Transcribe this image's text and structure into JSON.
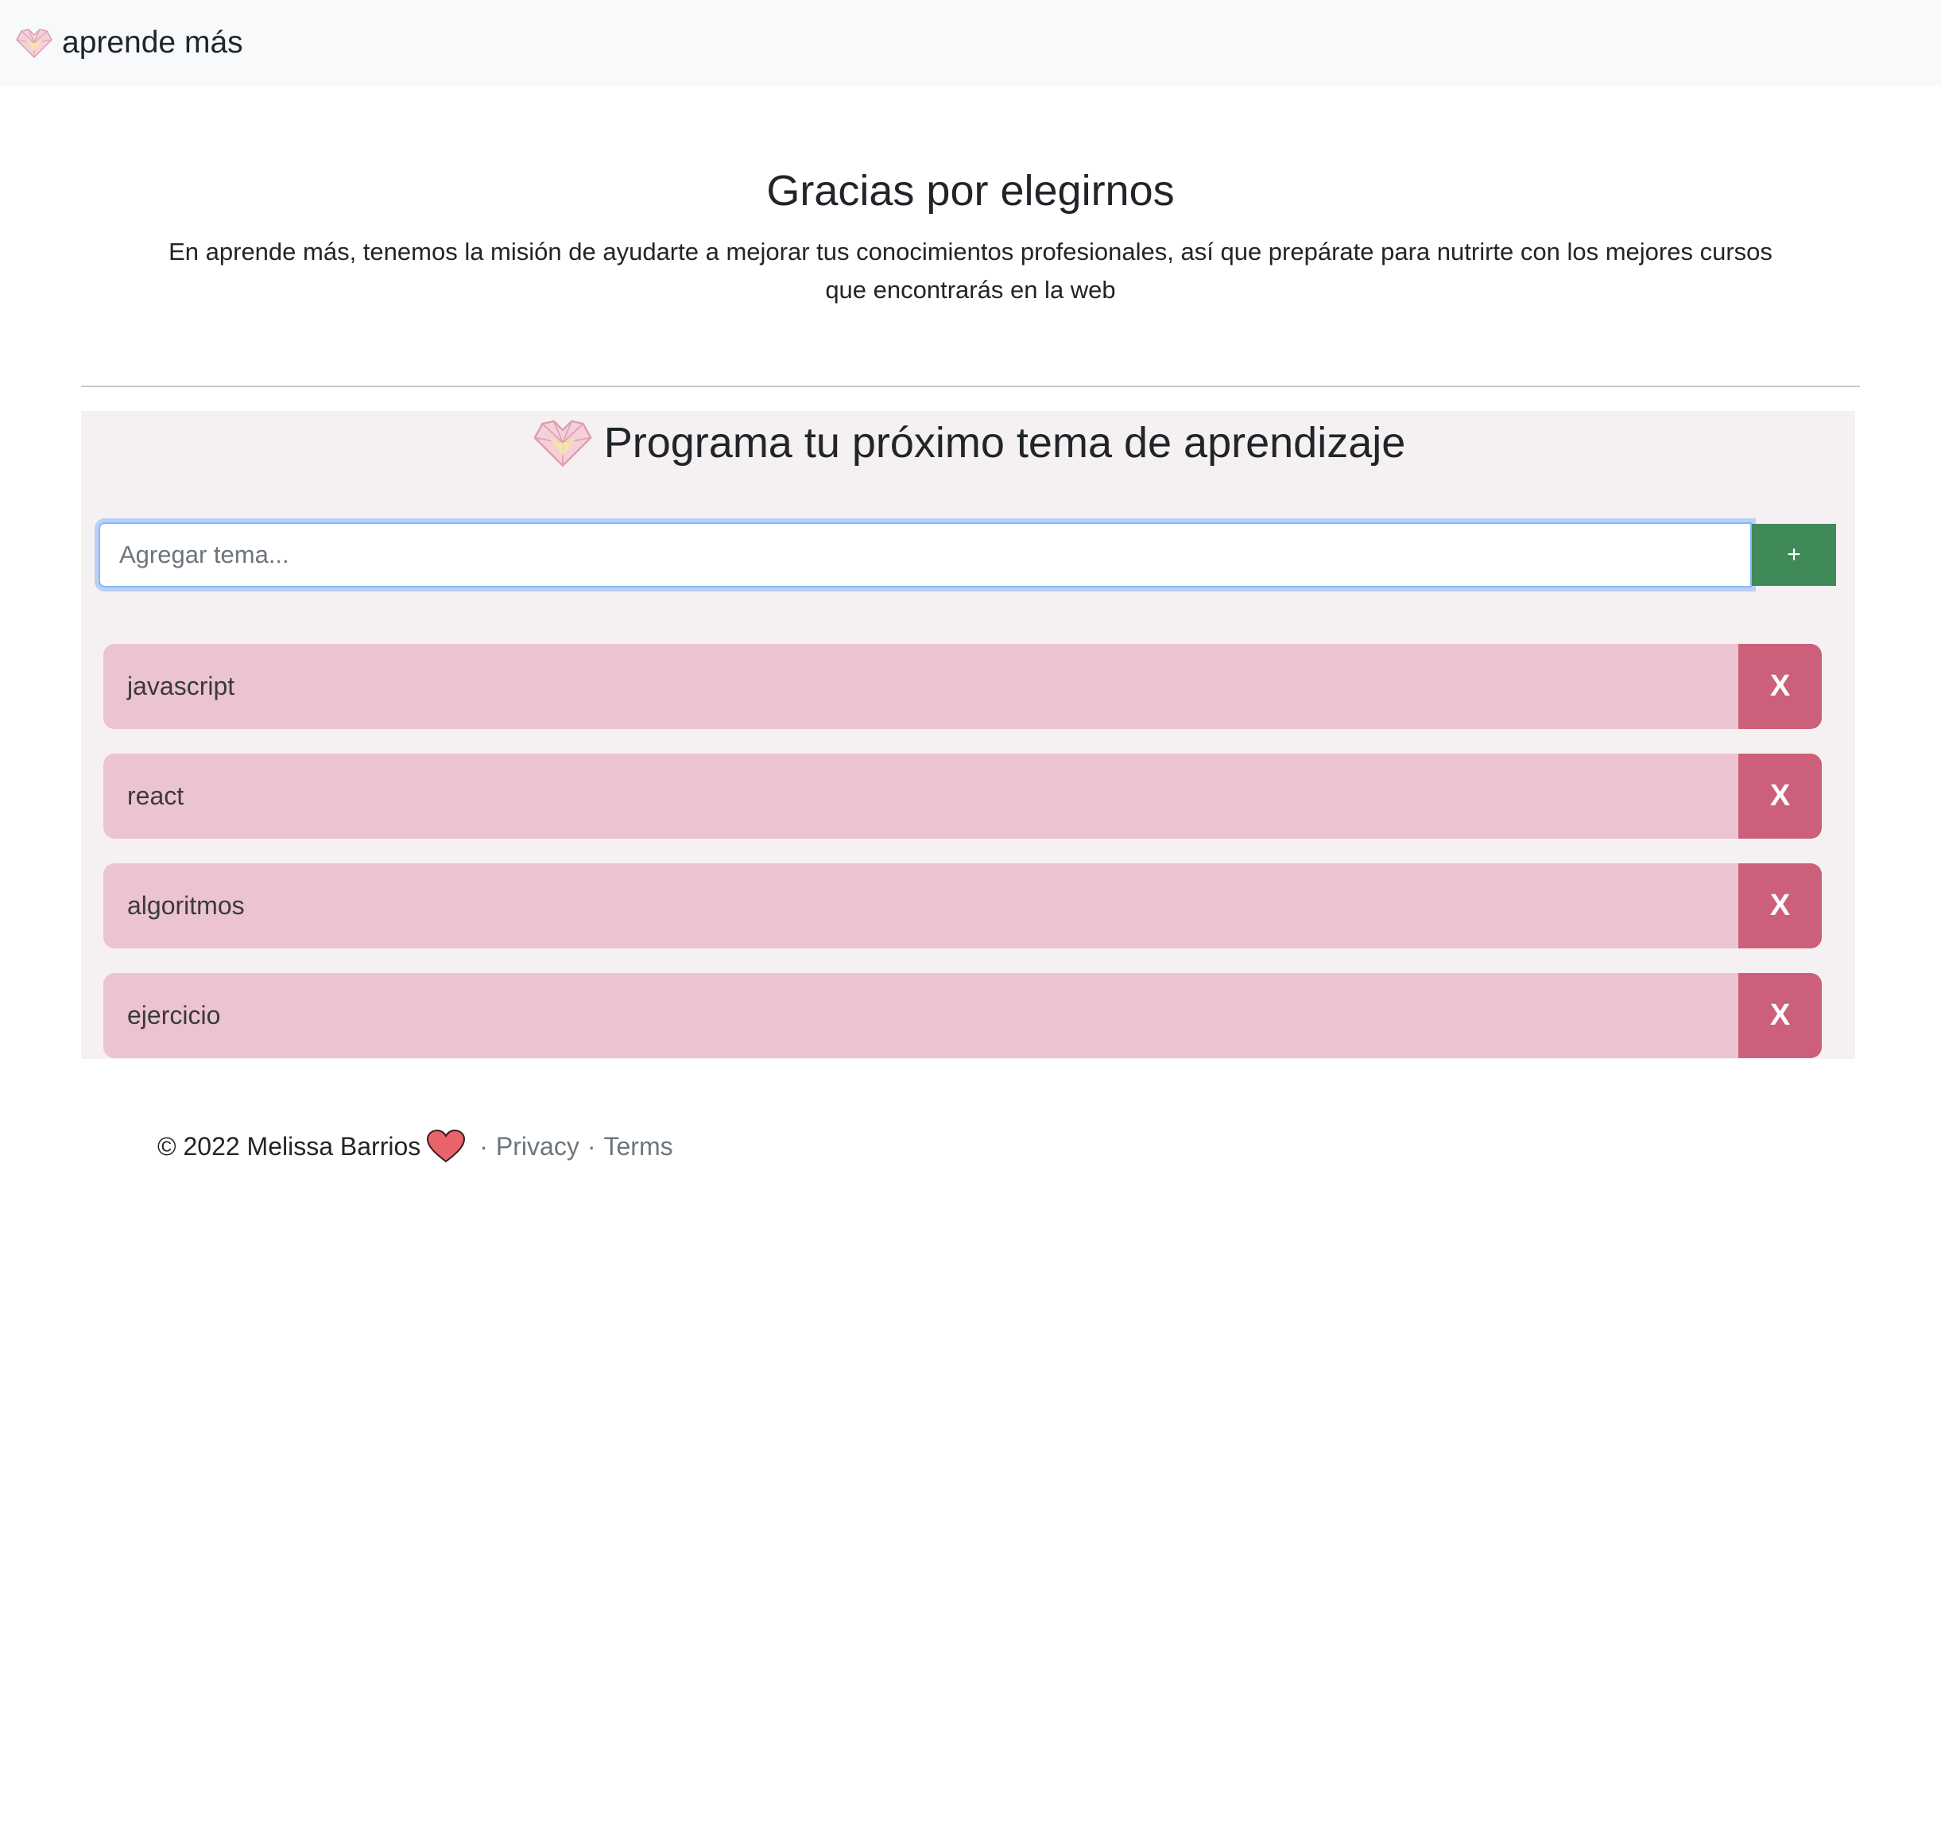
{
  "navbar": {
    "brand_label": "aprende más",
    "logo_icon": "gem-heart-icon"
  },
  "hero": {
    "title": "Gracias por elegirnos",
    "description": "En aprende más, tenemos la misión de ayudarte a mejorar tus conocimientos profesionales, así que prepárate para nutrirte con los mejores cursos que encontrarás en la web"
  },
  "planner": {
    "title": "Programa tu próximo tema de aprendizaje",
    "input_placeholder": "Agregar tema...",
    "input_value": "",
    "add_button_label": "+",
    "delete_button_label": "X",
    "topics": [
      {
        "label": "javascript"
      },
      {
        "label": "react"
      },
      {
        "label": "algoritmos"
      },
      {
        "label": "ejercicio"
      }
    ]
  },
  "footer": {
    "copyright": "© 2022 Melissa Barrios",
    "separator": "·",
    "privacy_label": "Privacy",
    "terms_label": "Terms",
    "heart_icon": "heart-icon"
  },
  "colors": {
    "navbar_bg": "#f8f9fa",
    "planner_bg": "#f5f0f1",
    "topic_bg": "#ecc4d1",
    "delete_bg": "#cc5f79",
    "add_bg": "#3f8a58",
    "link": "#6c757d"
  }
}
